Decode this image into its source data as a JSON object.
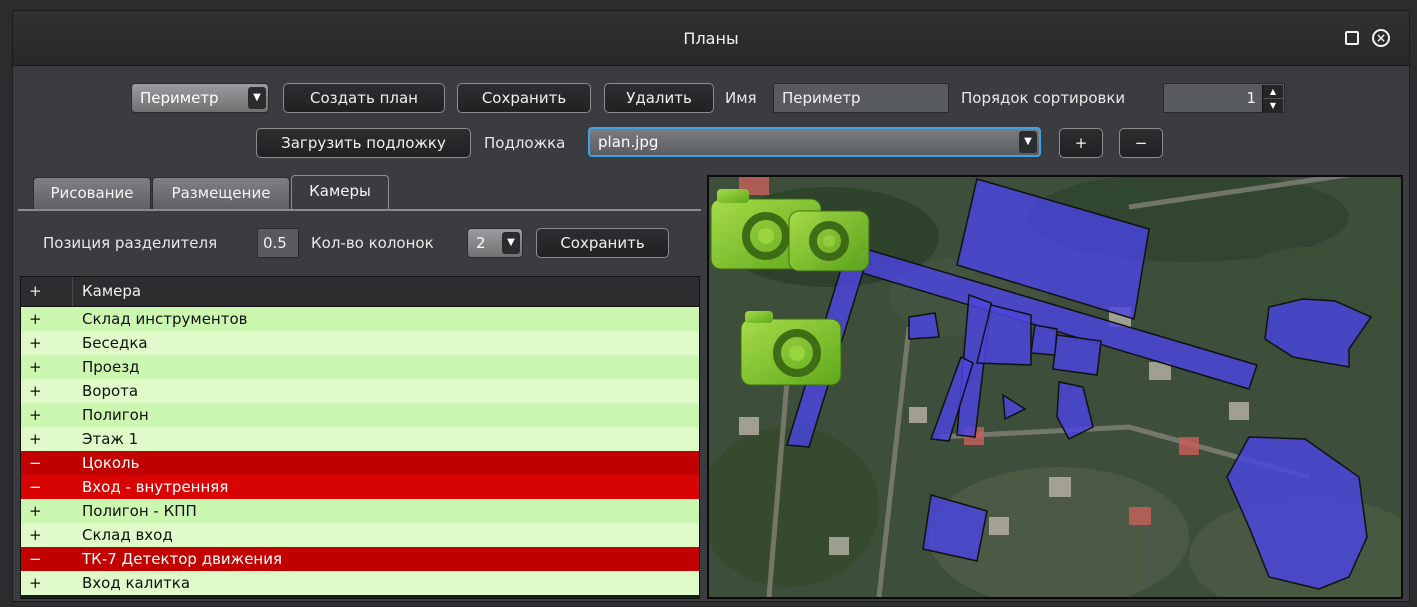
{
  "window": {
    "title": "Планы"
  },
  "toolbar": {
    "plan_select": "Периметр",
    "create_plan": "Создать план",
    "save": "Сохранить",
    "delete": "Удалить",
    "name_label": "Имя",
    "name_value": "Периметр",
    "sort_label": "Порядок сортировки",
    "sort_value": "1",
    "load_underlay": "Загрузить подложку",
    "underlay_label": "Подложка",
    "underlay_value": "plan.jpg",
    "add": "+",
    "remove": "−"
  },
  "tabs": [
    {
      "label": "Рисование",
      "active": false
    },
    {
      "label": "Размещение",
      "active": false
    },
    {
      "label": "Камеры",
      "active": true
    }
  ],
  "cameras_panel": {
    "divider_label": "Позиция разделителя",
    "divider_value": "0.5",
    "columns_label": "Кол-во колонок",
    "columns_value": "2",
    "save": "Сохранить"
  },
  "table": {
    "headers": [
      "+",
      "Камера"
    ],
    "rows": [
      {
        "mark": "+",
        "name": "Склад инструментов",
        "state": "on"
      },
      {
        "mark": "+",
        "name": "Беседка",
        "state": "on"
      },
      {
        "mark": "+",
        "name": "Проезд",
        "state": "on"
      },
      {
        "mark": "+",
        "name": "Ворота",
        "state": "on"
      },
      {
        "mark": "+",
        "name": "Полигон",
        "state": "on"
      },
      {
        "mark": "+",
        "name": "Этаж 1",
        "state": "on"
      },
      {
        "mark": "−",
        "name": "Цоколь",
        "state": "off"
      },
      {
        "mark": "−",
        "name": "Вход - внутренняя",
        "state": "off"
      },
      {
        "mark": "+",
        "name": "Полигон - КПП",
        "state": "on"
      },
      {
        "mark": "+",
        "name": "Склад вход",
        "state": "on"
      },
      {
        "mark": "−",
        "name": "ТК-7 Детектор движения",
        "state": "off"
      },
      {
        "mark": "+",
        "name": "Вход калитка",
        "state": "on"
      }
    ]
  },
  "map": {
    "zone_color": "#4a44e0",
    "camera_color": "#7ecb2a"
  }
}
